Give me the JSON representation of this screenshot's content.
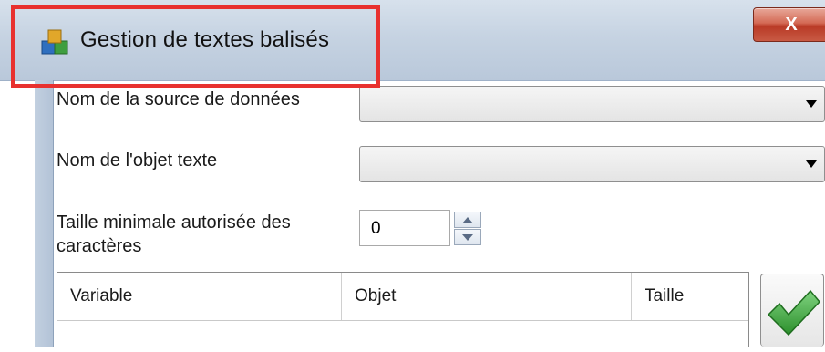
{
  "window": {
    "title": "Gestion de textes balisés",
    "close_label": "X"
  },
  "form": {
    "source_label": "Nom de la source de données",
    "source_value": "",
    "object_label": "Nom de l'objet texte",
    "object_value": "",
    "min_size_label_line1": "Taille minimale autorisée des",
    "min_size_label_line2": "caractères",
    "min_size_value": "0"
  },
  "table": {
    "columns": [
      "Variable",
      "Objet",
      "Taille"
    ],
    "rows": []
  },
  "icons": {
    "app": "app-cubes-icon",
    "close": "close-icon",
    "ok": "green-checkmark-icon",
    "dropdown": "chevron-down-icon",
    "spin_up": "arrow-up-icon",
    "spin_down": "arrow-down-icon"
  },
  "colors": {
    "highlight": "#e8312f",
    "titlebar": "#c6d3e2",
    "check_green": "#3aa53a"
  }
}
